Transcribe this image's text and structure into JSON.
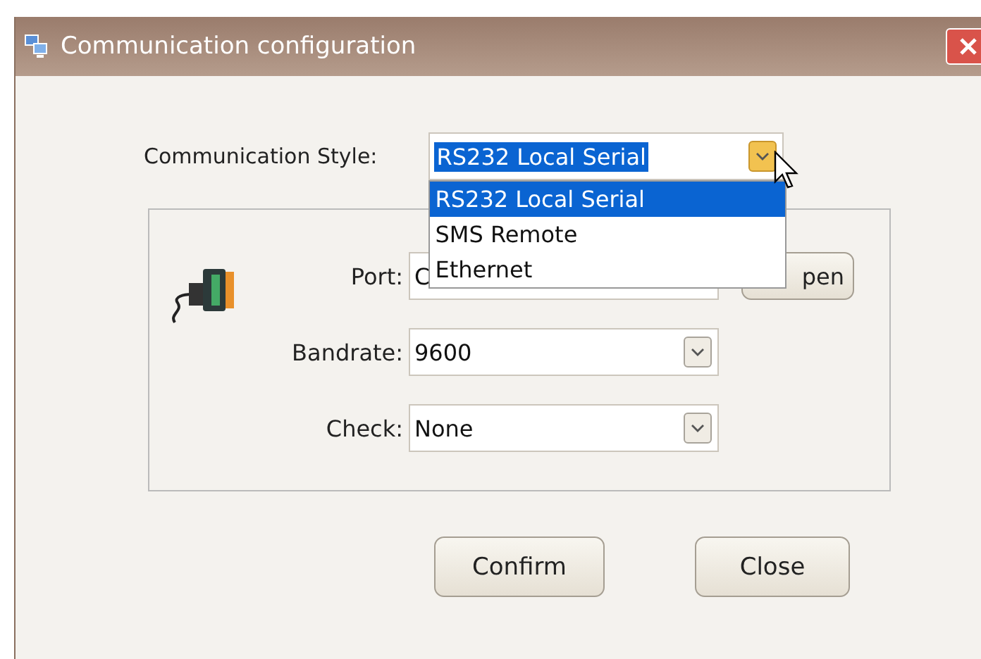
{
  "window": {
    "title": "Communication configuration"
  },
  "communication_style": {
    "label": "Communication Style:",
    "value": "RS232 Local Serial",
    "expanded": true,
    "options": [
      {
        "label": "RS232 Local Serial",
        "selected": true
      },
      {
        "label": "SMS Remote",
        "selected": false
      },
      {
        "label": "Ethernet",
        "selected": false
      }
    ]
  },
  "port": {
    "label": "Port:",
    "value": "C",
    "button": "pen"
  },
  "bandrate": {
    "label": "Bandrate:",
    "value": "9600"
  },
  "check": {
    "label": "Check:",
    "value": "None"
  },
  "buttons": [
    "Confirm",
    "Close"
  ]
}
